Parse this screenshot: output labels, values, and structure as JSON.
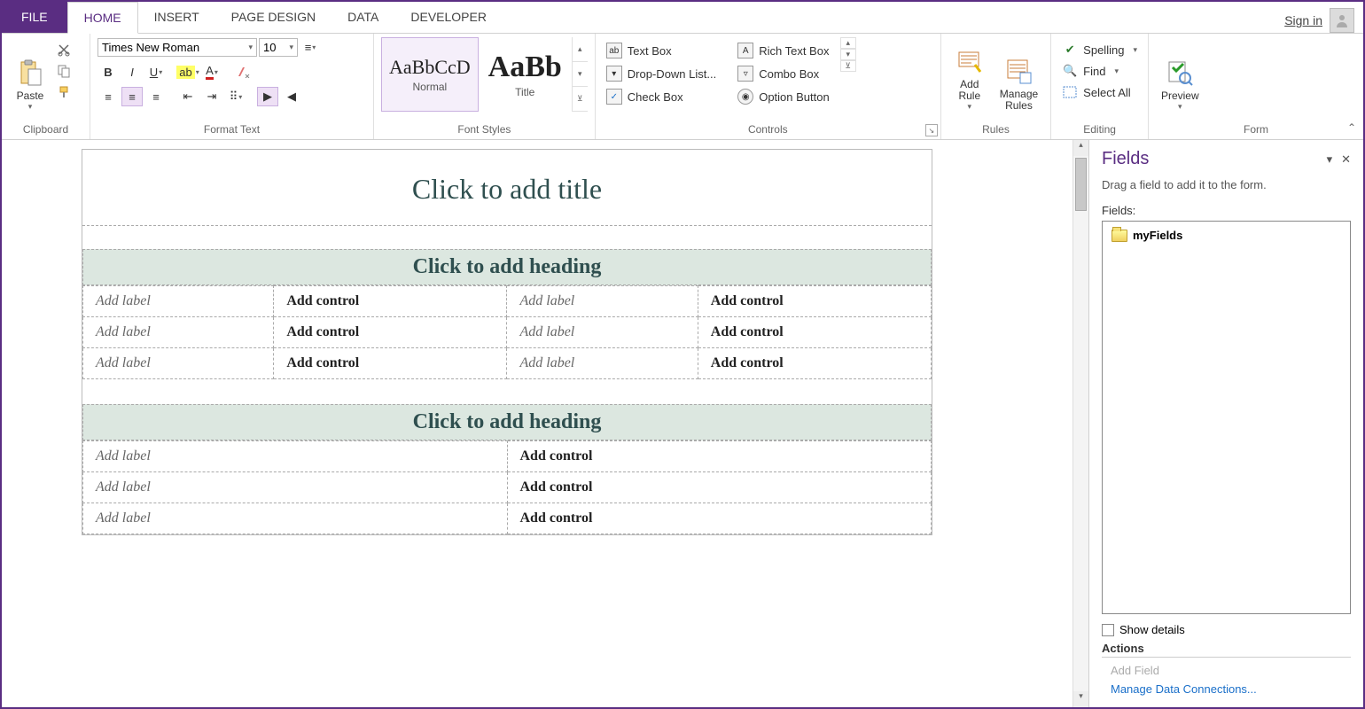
{
  "tabs": {
    "file": "FILE",
    "home": "HOME",
    "insert": "INSERT",
    "page_design": "PAGE DESIGN",
    "data": "DATA",
    "developer": "DEVELOPER"
  },
  "signin": "Sign in",
  "ribbon": {
    "clipboard": {
      "label": "Clipboard",
      "paste": "Paste"
    },
    "format_text": {
      "label": "Format Text",
      "font_name": "Times New Roman",
      "font_size": "10"
    },
    "font_styles": {
      "label": "Font Styles",
      "items": [
        {
          "preview": "AaBbCcD",
          "name": "Normal"
        },
        {
          "preview": "AaBb",
          "name": "Title"
        }
      ]
    },
    "controls": {
      "label": "Controls",
      "col1": [
        "Text Box",
        "Drop-Down List...",
        "Check Box"
      ],
      "col2": [
        "Rich Text Box",
        "Combo Box",
        "Option Button"
      ]
    },
    "rules": {
      "label": "Rules",
      "add_rule": "Add\nRule",
      "manage_rules": "Manage\nRules"
    },
    "editing": {
      "label": "Editing",
      "spelling": "Spelling",
      "find": "Find",
      "select_all": "Select All"
    },
    "form": {
      "label": "Form",
      "preview": "Preview"
    }
  },
  "canvas": {
    "title_placeholder": "Click to add title",
    "heading_placeholder": "Click to add heading",
    "label_placeholder": "Add label",
    "control_placeholder": "Add control"
  },
  "fields_pane": {
    "title": "Fields",
    "hint": "Drag a field to add it to the form.",
    "fields_label": "Fields:",
    "root": "myFields",
    "show_details": "Show details",
    "actions": "Actions",
    "add_field": "Add Field",
    "manage_conn": "Manage Data Connections..."
  }
}
